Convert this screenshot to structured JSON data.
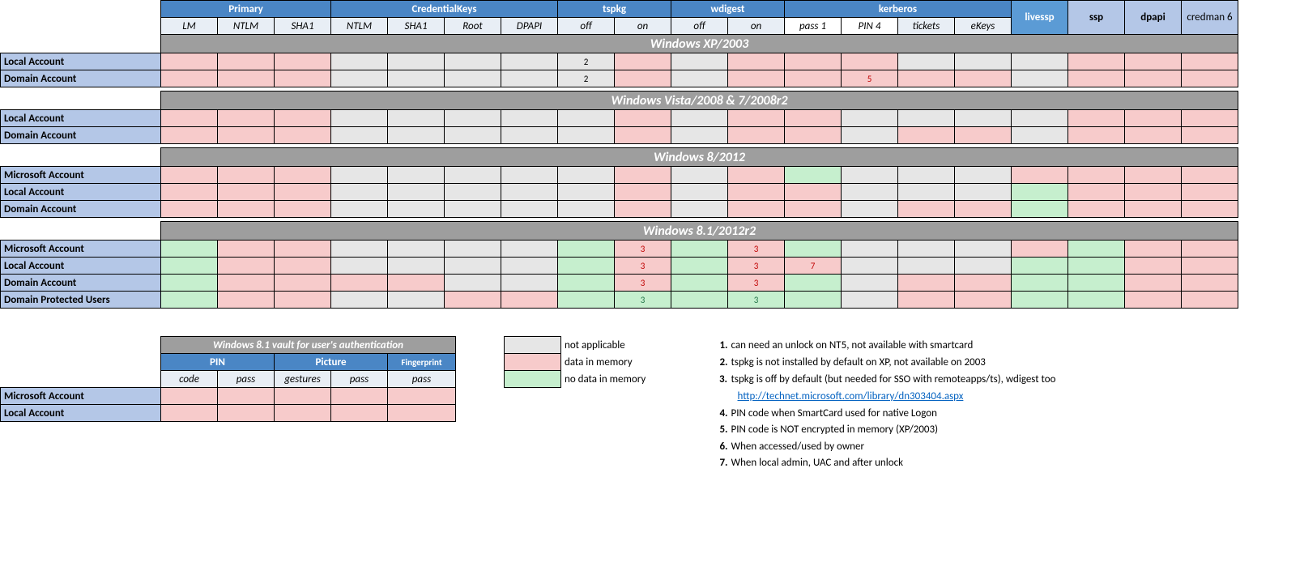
{
  "headers": {
    "groups": [
      "Primary",
      "CredentialKeys",
      "tspkg",
      "wdigest",
      "kerberos"
    ],
    "extra": [
      "livessp",
      "ssp",
      "dpapi",
      "credman 6"
    ],
    "subs": [
      "LM",
      "NTLM",
      "SHA1",
      "NTLM",
      "SHA1",
      "Root",
      "DPAPI",
      "off",
      "on",
      "off",
      "on",
      "pass 1",
      "PIN 4",
      "tickets",
      "eKeys"
    ]
  },
  "sections": [
    "Windows XP/2003",
    "Windows Vista/2008 & 7/2008r2",
    "Windows 8/2012",
    "Windows 8.1/2012r2"
  ],
  "rows": {
    "xp": [
      "Local Account",
      "Domain Account"
    ],
    "vista": [
      "Local Account",
      "Domain Account"
    ],
    "win8": [
      "Microsoft Account",
      "Local Account",
      "Domain Account"
    ],
    "win81": [
      "Microsoft Account",
      "Local Account",
      "Domain Account",
      "Domain Protected Users"
    ]
  },
  "chart_data": {
    "type": "table",
    "legend": {
      "grey": "not applicable",
      "pink": "data in memory",
      "green": "no data in memory"
    },
    "columns": [
      "LM",
      "NTLM",
      "SHA1",
      "CK_NTLM",
      "CK_SHA1",
      "CK_Root",
      "CK_DPAPI",
      "tspkg_off",
      "tspkg_on",
      "wdigest_off",
      "wdigest_on",
      "kerb_pass",
      "kerb_PIN",
      "kerb_tickets",
      "kerb_eKeys",
      "livessp",
      "ssp",
      "dpapi",
      "credman"
    ],
    "data": {
      "Windows XP/2003": {
        "Local Account": [
          "pink",
          "pink",
          "pink",
          "grey",
          "grey",
          "grey",
          "grey",
          "grey:2",
          "pink",
          "grey",
          "pink",
          "pink",
          "pink",
          "grey",
          "grey",
          "grey",
          "pink",
          "pink",
          "pink"
        ],
        "Domain Account": [
          "pink",
          "pink",
          "pink",
          "grey",
          "grey",
          "grey",
          "grey",
          "grey:2",
          "pink",
          "grey",
          "pink",
          "pink",
          "pink:5",
          "pink",
          "pink",
          "grey",
          "pink",
          "pink",
          "pink"
        ]
      },
      "Windows Vista/2008 & 7/2008r2": {
        "Local Account": [
          "pink",
          "pink",
          "pink",
          "grey",
          "grey",
          "grey",
          "grey",
          "grey",
          "pink",
          "grey",
          "pink",
          "pink",
          "grey",
          "grey",
          "grey",
          "grey",
          "pink",
          "pink",
          "pink"
        ],
        "Domain Account": [
          "pink",
          "pink",
          "pink",
          "grey",
          "grey",
          "grey",
          "grey",
          "grey",
          "pink",
          "grey",
          "pink",
          "pink",
          "grey",
          "pink",
          "pink",
          "grey",
          "pink",
          "pink",
          "pink"
        ]
      },
      "Windows 8/2012": {
        "Microsoft Account": [
          "pink",
          "pink",
          "pink",
          "grey",
          "grey",
          "grey",
          "grey",
          "grey",
          "pink",
          "grey",
          "pink",
          "green",
          "grey",
          "grey",
          "grey",
          "pink",
          "pink",
          "pink",
          "pink"
        ],
        "Local Account": [
          "pink",
          "pink",
          "pink",
          "grey",
          "grey",
          "grey",
          "grey",
          "grey",
          "pink",
          "grey",
          "pink",
          "pink",
          "grey",
          "grey",
          "grey",
          "green",
          "pink",
          "pink",
          "pink"
        ],
        "Domain Account": [
          "pink",
          "pink",
          "pink",
          "grey",
          "grey",
          "grey",
          "grey",
          "grey",
          "pink",
          "grey",
          "pink",
          "pink",
          "grey",
          "pink",
          "pink",
          "green",
          "pink",
          "pink",
          "pink"
        ]
      },
      "Windows 8.1/2012r2": {
        "Microsoft Account": [
          "green",
          "pink",
          "pink",
          "grey",
          "grey",
          "grey",
          "grey",
          "green",
          "pink:3",
          "green",
          "pink:3",
          "green",
          "grey",
          "grey",
          "grey",
          "pink",
          "green",
          "pink",
          "pink"
        ],
        "Local Account": [
          "green",
          "pink",
          "pink",
          "grey",
          "grey",
          "grey",
          "grey",
          "green",
          "pink:3",
          "green",
          "pink:3",
          "pink:7",
          "grey",
          "grey",
          "grey",
          "green",
          "green",
          "pink",
          "pink"
        ],
        "Domain Account": [
          "green",
          "pink",
          "pink",
          "pink",
          "pink",
          "grey",
          "grey",
          "green",
          "pink:3",
          "green",
          "pink:3",
          "green",
          "grey",
          "pink",
          "pink",
          "green",
          "green",
          "pink",
          "pink"
        ],
        "Domain Protected Users": [
          "green",
          "pink",
          "pink",
          "grey",
          "grey",
          "pink",
          "pink",
          "green",
          "green:3",
          "green",
          "green:3",
          "green",
          "grey",
          "pink",
          "pink",
          "green",
          "green",
          "pink",
          "pink"
        ]
      }
    }
  },
  "vault": {
    "title": "Windows 8.1 vault for user's authentication",
    "groups": [
      "PIN",
      "Picture",
      "Fingerprint"
    ],
    "subs": [
      "code",
      "pass",
      "gestures",
      "pass",
      "pass"
    ],
    "rows": [
      "Microsoft Account",
      "Local Account"
    ],
    "data": {
      "Microsoft Account": [
        "pink",
        "pink",
        "pink",
        "pink",
        "pink"
      ],
      "Local Account": [
        "pink",
        "pink",
        "pink",
        "pink",
        "pink"
      ]
    }
  },
  "legend": {
    "grey": "not applicable",
    "pink": "data in memory",
    "green": "no data in memory"
  },
  "notes": {
    "n1": "can need an unlock on NT5, not available with smartcard",
    "n2": "tspkg is not installed by default on XP, not available on 2003",
    "n3": "tspkg is off by default (but needed for SSO with remoteapps/ts), wdigest too",
    "link": "http://technet.microsoft.com/library/dn303404.aspx",
    "n4": "PIN code when SmartCard used for native Logon",
    "n5": "PIN code is NOT encrypted in memory (XP/2003)",
    "n6": "When accessed/used by owner",
    "n7": "When local admin, UAC and after unlock"
  },
  "labels": {
    "one": "1.",
    "two": "2.",
    "three": "3.",
    "four": "4.",
    "five": "5.",
    "six": "6.",
    "seven": "7."
  }
}
